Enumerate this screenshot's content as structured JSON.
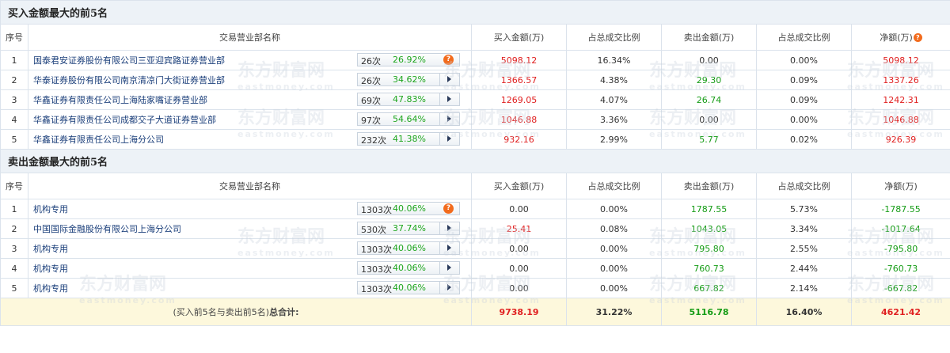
{
  "buy_section": {
    "title": "买入金额最大的前5名",
    "headers": [
      "序号",
      "交易营业部名称",
      "买入金额(万)",
      "占总成交比例",
      "卖出金额(万)",
      "占总成交比例",
      "净额(万)"
    ],
    "rows": [
      {
        "idx": "1",
        "name": "国泰君安证券股份有限公司三亚迎宾路证券营业部",
        "count": "26次",
        "pct": "26.92%",
        "buy": "5098.12",
        "buy_ratio": "16.34%",
        "sell": "0.00",
        "sell_ratio": "0.00%",
        "net": "5098.12"
      },
      {
        "idx": "2",
        "name": "华泰证券股份有限公司南京清凉门大街证券营业部",
        "count": "26次",
        "pct": "34.62%",
        "buy": "1366.57",
        "buy_ratio": "4.38%",
        "sell": "29.30",
        "sell_ratio": "0.09%",
        "net": "1337.26"
      },
      {
        "idx": "3",
        "name": "华鑫证券有限责任公司上海陆家嘴证券营业部",
        "count": "69次",
        "pct": "47.83%",
        "buy": "1269.05",
        "buy_ratio": "4.07%",
        "sell": "26.74",
        "sell_ratio": "0.09%",
        "net": "1242.31"
      },
      {
        "idx": "4",
        "name": "华鑫证券有限责任公司成都交子大道证券营业部",
        "count": "97次",
        "pct": "54.64%",
        "buy": "1046.88",
        "buy_ratio": "3.36%",
        "sell": "0.00",
        "sell_ratio": "0.00%",
        "net": "1046.88"
      },
      {
        "idx": "5",
        "name": "华鑫证券有限责任公司上海分公司",
        "count": "232次",
        "pct": "41.38%",
        "buy": "932.16",
        "buy_ratio": "2.99%",
        "sell": "5.77",
        "sell_ratio": "0.02%",
        "net": "926.39"
      }
    ]
  },
  "sell_section": {
    "title": "卖出金额最大的前5名",
    "headers": [
      "序号",
      "交易营业部名称",
      "买入金额(万)",
      "占总成交比例",
      "卖出金额(万)",
      "占总成交比例",
      "净额(万)"
    ],
    "rows": [
      {
        "idx": "1",
        "name": "机构专用",
        "count": "1303次",
        "pct": "40.06%",
        "buy": "0.00",
        "buy_ratio": "0.00%",
        "sell": "1787.55",
        "sell_ratio": "5.73%",
        "net": "-1787.55"
      },
      {
        "idx": "2",
        "name": "中国国际金融股份有限公司上海分公司",
        "count": "530次",
        "pct": "37.74%",
        "buy": "25.41",
        "buy_ratio": "0.08%",
        "sell": "1043.05",
        "sell_ratio": "3.34%",
        "net": "-1017.64"
      },
      {
        "idx": "3",
        "name": "机构专用",
        "count": "1303次",
        "pct": "40.06%",
        "buy": "0.00",
        "buy_ratio": "0.00%",
        "sell": "795.80",
        "sell_ratio": "2.55%",
        "net": "-795.80"
      },
      {
        "idx": "4",
        "name": "机构专用",
        "count": "1303次",
        "pct": "40.06%",
        "buy": "0.00",
        "buy_ratio": "0.00%",
        "sell": "760.73",
        "sell_ratio": "2.44%",
        "net": "-760.73"
      },
      {
        "idx": "5",
        "name": "机构专用",
        "count": "1303次",
        "pct": "40.06%",
        "buy": "0.00",
        "buy_ratio": "0.00%",
        "sell": "667.82",
        "sell_ratio": "2.14%",
        "net": "-667.82"
      }
    ]
  },
  "total": {
    "label_plain": "(买入前5名与卖出前5名)",
    "label_bold": "总合计:",
    "buy": "9738.19",
    "buy_ratio": "31.22%",
    "sell": "5116.78",
    "sell_ratio": "16.40%",
    "net": "4621.42"
  },
  "icons": {
    "help": "?",
    "help_icon": "question-bubble-icon",
    "arrow_icon": "play-arrow-icon"
  },
  "watermark": {
    "cn": "东方财富网",
    "en": "eastmoney.com"
  },
  "colors": {
    "positive": "#e02020",
    "negative": "#169c16",
    "header_bg": "#edf2f7",
    "total_bg": "#fdf8dc",
    "accent_icon": "#f26b1d"
  }
}
